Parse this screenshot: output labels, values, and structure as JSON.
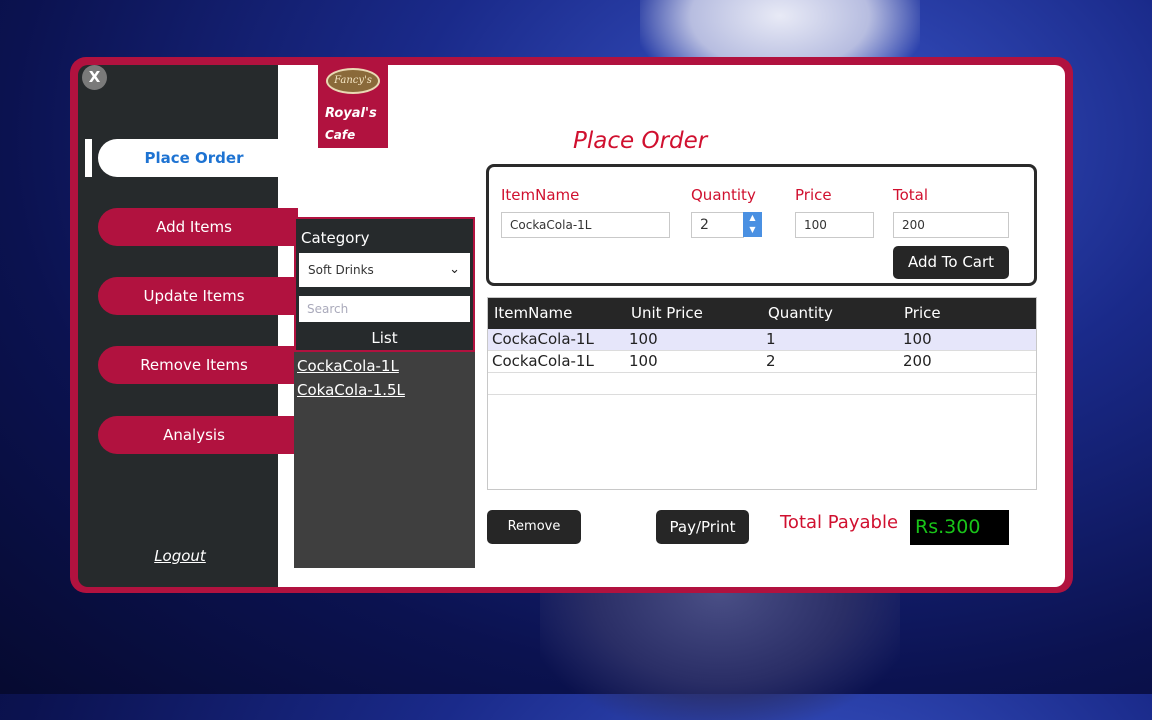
{
  "window": {
    "close_label": "X"
  },
  "logo": {
    "badge_text": "Fancy's",
    "title": "Royal's",
    "subtitle": "Cafe"
  },
  "sidebar": {
    "items": [
      {
        "label": "Place Order"
      },
      {
        "label": "Add Items"
      },
      {
        "label": "Update Items"
      },
      {
        "label": "Remove Items"
      },
      {
        "label": "Analysis"
      }
    ],
    "logout": "Logout"
  },
  "page": {
    "title": "Place Order"
  },
  "order_form": {
    "item_name_label": "ItemName",
    "item_name_value": "CockaCola-1L",
    "quantity_label": "Quantity",
    "quantity_value": "2",
    "price_label": "Price",
    "price_value": "100",
    "total_label": "Total",
    "total_value": "200",
    "add_to_cart": "Add To Cart"
  },
  "category": {
    "label": "Category",
    "selected": "Soft Drinks",
    "search_placeholder": "Search",
    "list_label": "List",
    "items": [
      "CockaCola-1L",
      "CokaCola-1.5L"
    ]
  },
  "cart": {
    "headers": [
      "ItemName",
      "Unit Price",
      "Quantity",
      "Price"
    ],
    "rows": [
      [
        "CockaCola-1L",
        "100",
        "1",
        "100"
      ],
      [
        "CockaCola-1L",
        "100",
        "2",
        "200"
      ]
    ]
  },
  "actions": {
    "remove": "Remove",
    "pay_print": "Pay/Print"
  },
  "totals": {
    "label": "Total Payable",
    "value": "Rs.300"
  },
  "colors": {
    "accent": "#b1123f",
    "sidebar": "#262a2c",
    "title_red": "#d0102f",
    "active_blue": "#1e73d2",
    "total_green": "#19c419"
  }
}
